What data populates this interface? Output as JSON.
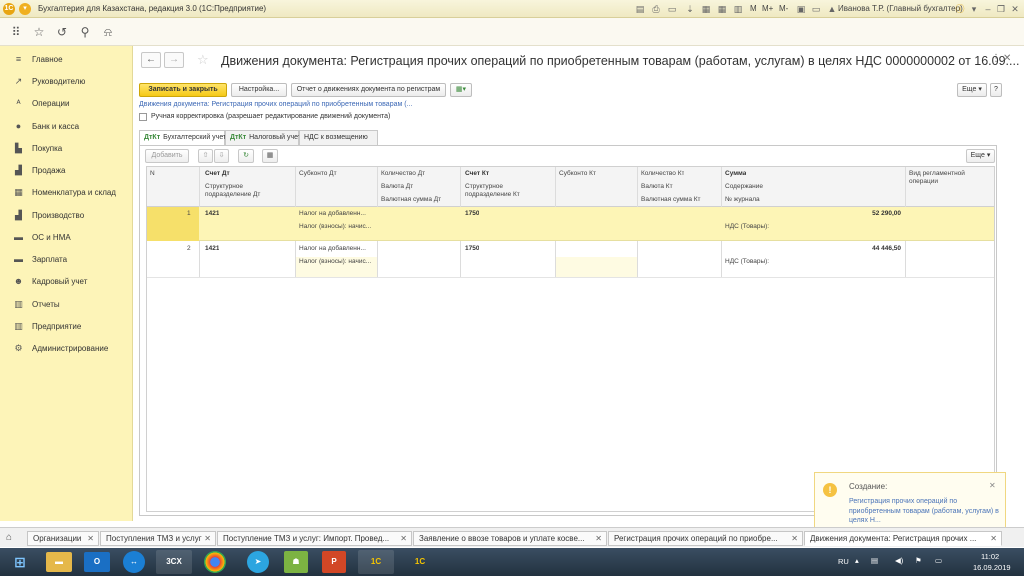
{
  "window": {
    "title": "Бухгалтерия для Казахстана, редакция 3.0  (1С:Предприятие)",
    "toolbar_m": "M",
    "toolbar_mplus": "M+",
    "toolbar_mminus": "M-",
    "user": "Иванова Т.Р. (Главный бухгалтер)"
  },
  "sidebar": {
    "items": [
      {
        "label": "Главное",
        "icon": "menu-icon"
      },
      {
        "label": "Руководителю",
        "icon": "chart-line-icon"
      },
      {
        "label": "Операции",
        "icon": "operations-icon"
      },
      {
        "label": "Банк и касса",
        "icon": "bank-icon"
      },
      {
        "label": "Покупка",
        "icon": "cart-icon"
      },
      {
        "label": "Продажа",
        "icon": "sale-icon"
      },
      {
        "label": "Номенклатура и склад",
        "icon": "warehouse-icon"
      },
      {
        "label": "Производство",
        "icon": "factory-icon"
      },
      {
        "label": "ОС и НМА",
        "icon": "assets-icon"
      },
      {
        "label": "Зарплата",
        "icon": "salary-icon"
      },
      {
        "label": "Кадровый учет",
        "icon": "people-icon"
      },
      {
        "label": "Отчеты",
        "icon": "reports-icon"
      },
      {
        "label": "Предприятие",
        "icon": "enterprise-icon"
      },
      {
        "label": "Администрирование",
        "icon": "gear-icon"
      }
    ]
  },
  "doc": {
    "title": "Движения документа: Регистрация прочих операций по приобретенным товарам (работам, услугам) в целях НДС 0000000002 от 16.09....",
    "btn_save_close": "Записать и закрыть",
    "btn_settings": "Настройка...",
    "btn_report": "Отчет о движениях документа по регистрам",
    "btn_more": "Еще",
    "doc_link_label": "Движения документа:",
    "doc_link": "Регистрация прочих операций по приобретенным товарам (...",
    "manual_label": "Ручная корректировка (разрешает редактирование движений документа)",
    "tabs": [
      {
        "label": "Бухгалтерский учет",
        "icon": "Дт Кт"
      },
      {
        "label": "Налоговый учет",
        "icon": "Дт Кт"
      },
      {
        "label": "НДС к возмещению",
        "icon": ""
      }
    ],
    "btn_add": "Добавить",
    "btn_more2": "Еще"
  },
  "grid": {
    "headers": {
      "n": "N",
      "acc_dt": "Счет Дт",
      "div_dt": "Структурное подразделение Дт",
      "sub_dt": "Субконто Дт",
      "qty_dt": "Количество Дт",
      "cur_dt": "Валюта Дт",
      "cursum_dt": "Валютная сумма Дт",
      "acc_kt": "Счет Кт",
      "div_kt": "Структурное подразделение Кт",
      "sub_kt": "Субконто Кт",
      "qty_kt": "Количество Кт",
      "cur_kt": "Валюта Кт",
      "cursum_kt": "Валютная сумма Кт",
      "sum": "Сумма",
      "content": "Содержание",
      "journal": "№ журнала",
      "reg_op": "Вид регламентной операции"
    },
    "rows": [
      {
        "n": "1",
        "acc_dt": "1421",
        "sub1": "Налог на добавленн...",
        "sub2": "Налог (взносы): начис...",
        "acc_kt": "1750",
        "sum": "52 290,00",
        "content": "НДС (Товары):"
      },
      {
        "n": "2",
        "acc_dt": "1421",
        "sub1": "Налог на добавленн...",
        "sub2": "Налог (взносы): начис...",
        "acc_kt": "1750",
        "sum": "44 446,50",
        "content": "НДС (Товары):"
      }
    ]
  },
  "notification": {
    "title": "Создание:",
    "text": "Регистрация прочих операций по приобретенным товарам (работам, услугам) в целях Н..."
  },
  "open_tabs": [
    "Организации",
    "Поступления ТМЗ и услуг",
    "Поступление ТМЗ и услуг: Импорт. Провед...",
    "Заявление о ввозе товаров и уплате косве...",
    "Регистрация прочих операций по приобре...",
    "Движения документа: Регистрация прочих ..."
  ],
  "taskbar": {
    "apps": [
      "start-icon",
      "explorer-icon",
      "outlook-icon",
      "teamviewer-icon",
      "3cx-icon",
      "chrome-icon",
      "telegram-icon",
      "android-icon",
      "powerpoint-icon",
      "1c-icon",
      "1c-icon-2"
    ],
    "lang": "RU",
    "time": "11:02",
    "date": "16.09.2019"
  },
  "colors": {
    "sidebar_bg": "#fdf4b8",
    "primary_button": "#f5c916",
    "selected_row": "#fdf5b6",
    "link": "#3c68b5"
  }
}
